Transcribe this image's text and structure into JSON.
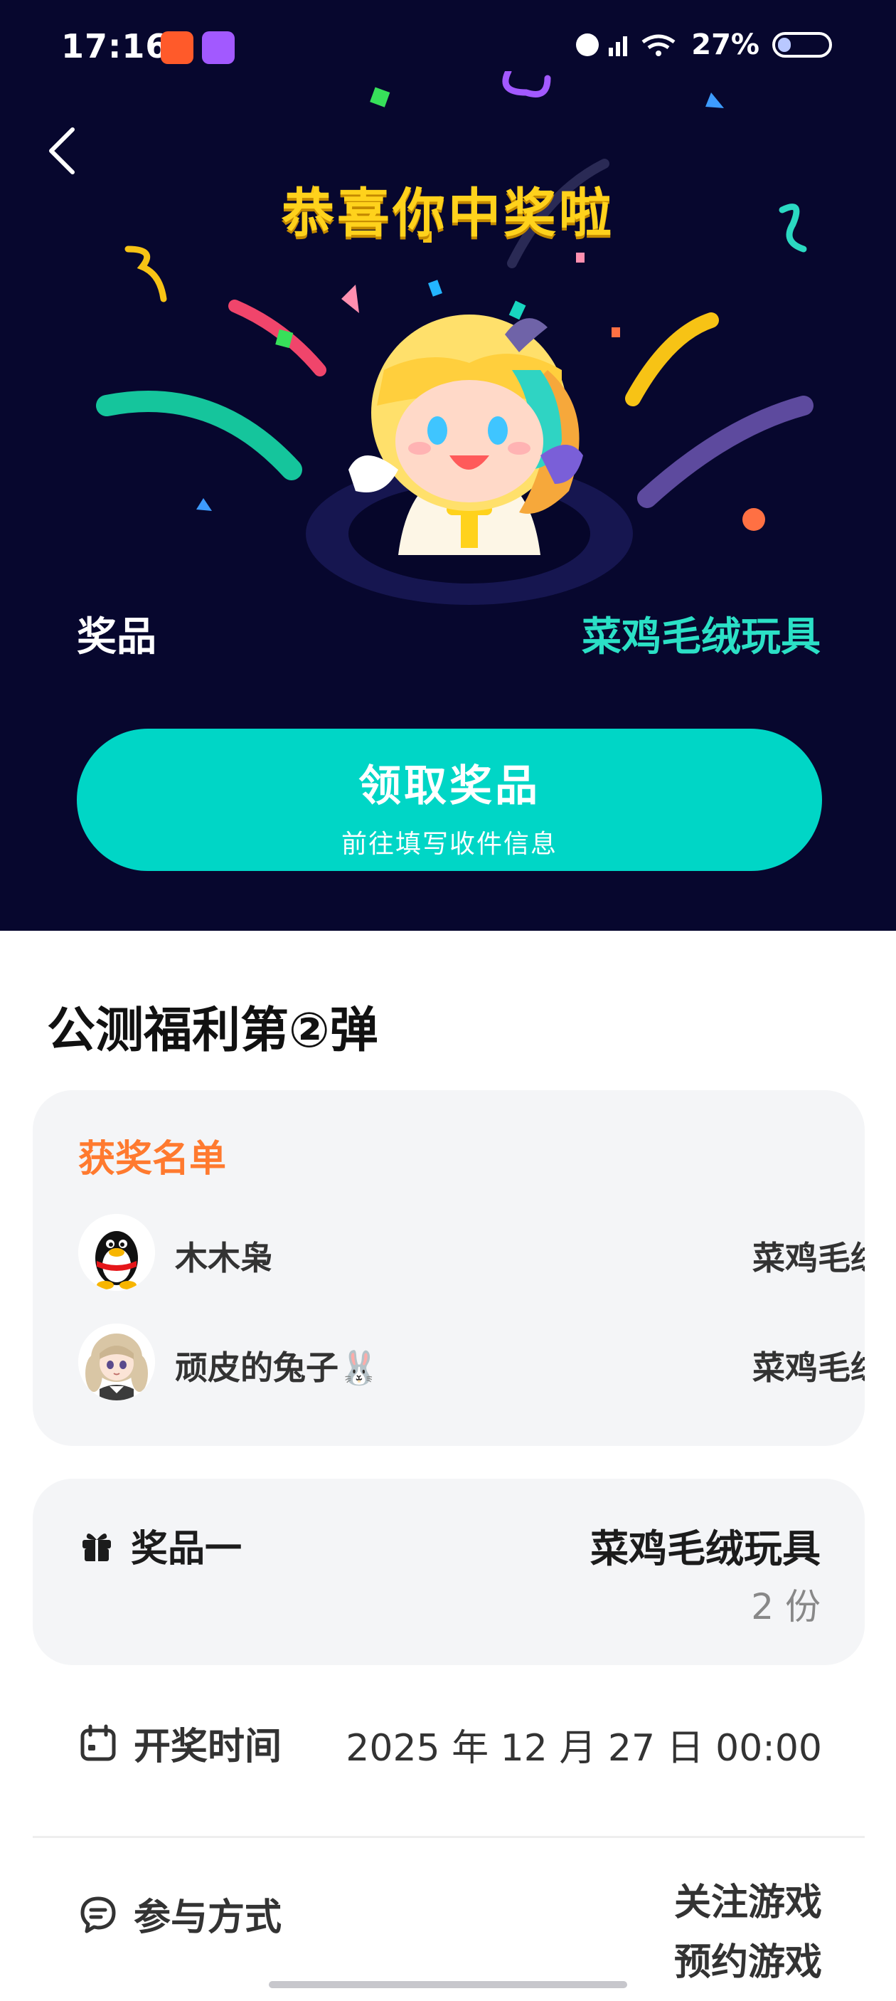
{
  "status_bar": {
    "time": "17:16",
    "battery": "27%"
  },
  "hero": {
    "title": "恭喜你中奖啦",
    "prize_label": "奖品",
    "prize_value": "菜鸡毛绒玩具",
    "claim_button": {
      "label": "领取奖品",
      "sublabel": "前往填写收件信息"
    }
  },
  "activity": {
    "title": "公测福利第②弹"
  },
  "winners": {
    "heading": "获奖名单",
    "rows": [
      {
        "name": "木木枭",
        "prize": "菜鸡毛绒玩具",
        "avatar": "penguin-avatar"
      },
      {
        "name": "顽皮的兔子🐰",
        "prize": "菜鸡毛绒玩具",
        "avatar": "anime-girl-avatar"
      }
    ]
  },
  "prize_detail": {
    "tier_label": "奖品一",
    "name": "菜鸡毛绒玩具",
    "count": "2 份",
    "icon": "gift-icon"
  },
  "draw_time": {
    "label": "开奖时间",
    "value": "2025 年 12 月 27 日 00:00",
    "icon": "calendar-icon"
  },
  "participation": {
    "label": "参与方式",
    "values": [
      "关注游戏",
      "预约游戏"
    ],
    "icon": "chat-icon"
  },
  "colors": {
    "hero_bg": "#07072e",
    "accent_teal": "#00d6c6",
    "title_yellow": "#ffd21c",
    "winner_heading": "#ff7a2f"
  }
}
